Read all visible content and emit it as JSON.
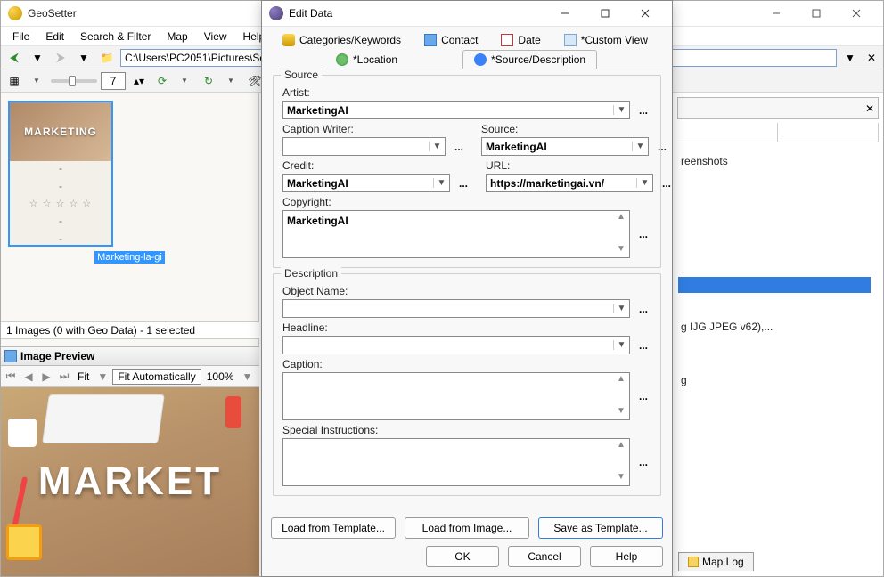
{
  "main": {
    "title": "GeoSetter",
    "menu": [
      "File",
      "Edit",
      "Search & Filter",
      "Map",
      "View",
      "Help"
    ],
    "path": "C:\\Users\\PC2051\\Pictures\\Screenshots",
    "zoom_value": "7",
    "thumb": {
      "overlay": "MARKETING",
      "filename": "Marketing-la-gi",
      "dash": "-",
      "stars": "☆ ☆ ☆ ☆ ☆"
    },
    "status": "1 Images (0 with Geo Data) - 1 selected",
    "preview": {
      "title": "Image Preview",
      "fit_label": "Fit",
      "fit_mode": "Fit Automatically",
      "zoom": "100%",
      "big_text": "MARKET"
    }
  },
  "right": {
    "line1_suffix": "reenshots",
    "line2_suffix": "g IJG JPEG v62),...",
    "line3_suffix": "g",
    "map_log_tab": "Map Log"
  },
  "dialog": {
    "title": "Edit Data",
    "tabs_top": [
      "Categories/Keywords",
      "Contact",
      "Date",
      "*Custom View"
    ],
    "tabs_bottom": [
      "*Location",
      "*Source/Description"
    ],
    "source": {
      "group": "Source",
      "artist_label": "Artist:",
      "artist": "MarketingAI",
      "caption_writer_label": "Caption Writer:",
      "caption_writer": "",
      "source_label": "Source:",
      "source": "MarketingAI",
      "credit_label": "Credit:",
      "credit": "MarketingAI",
      "url_label": "URL:",
      "url": "https://marketingai.vn/",
      "copyright_label": "Copyright:",
      "copyright": "MarketingAI"
    },
    "description": {
      "group": "Description",
      "object_label": "Object Name:",
      "object": "",
      "headline_label": "Headline:",
      "headline": "",
      "caption_label": "Caption:",
      "caption": "",
      "special_label": "Special Instructions:",
      "special": ""
    },
    "buttons": {
      "load_template": "Load from Template...",
      "load_image": "Load from Image...",
      "save_template": "Save as Template...",
      "ok": "OK",
      "cancel": "Cancel",
      "help": "Help"
    },
    "ellipsis": "..."
  }
}
